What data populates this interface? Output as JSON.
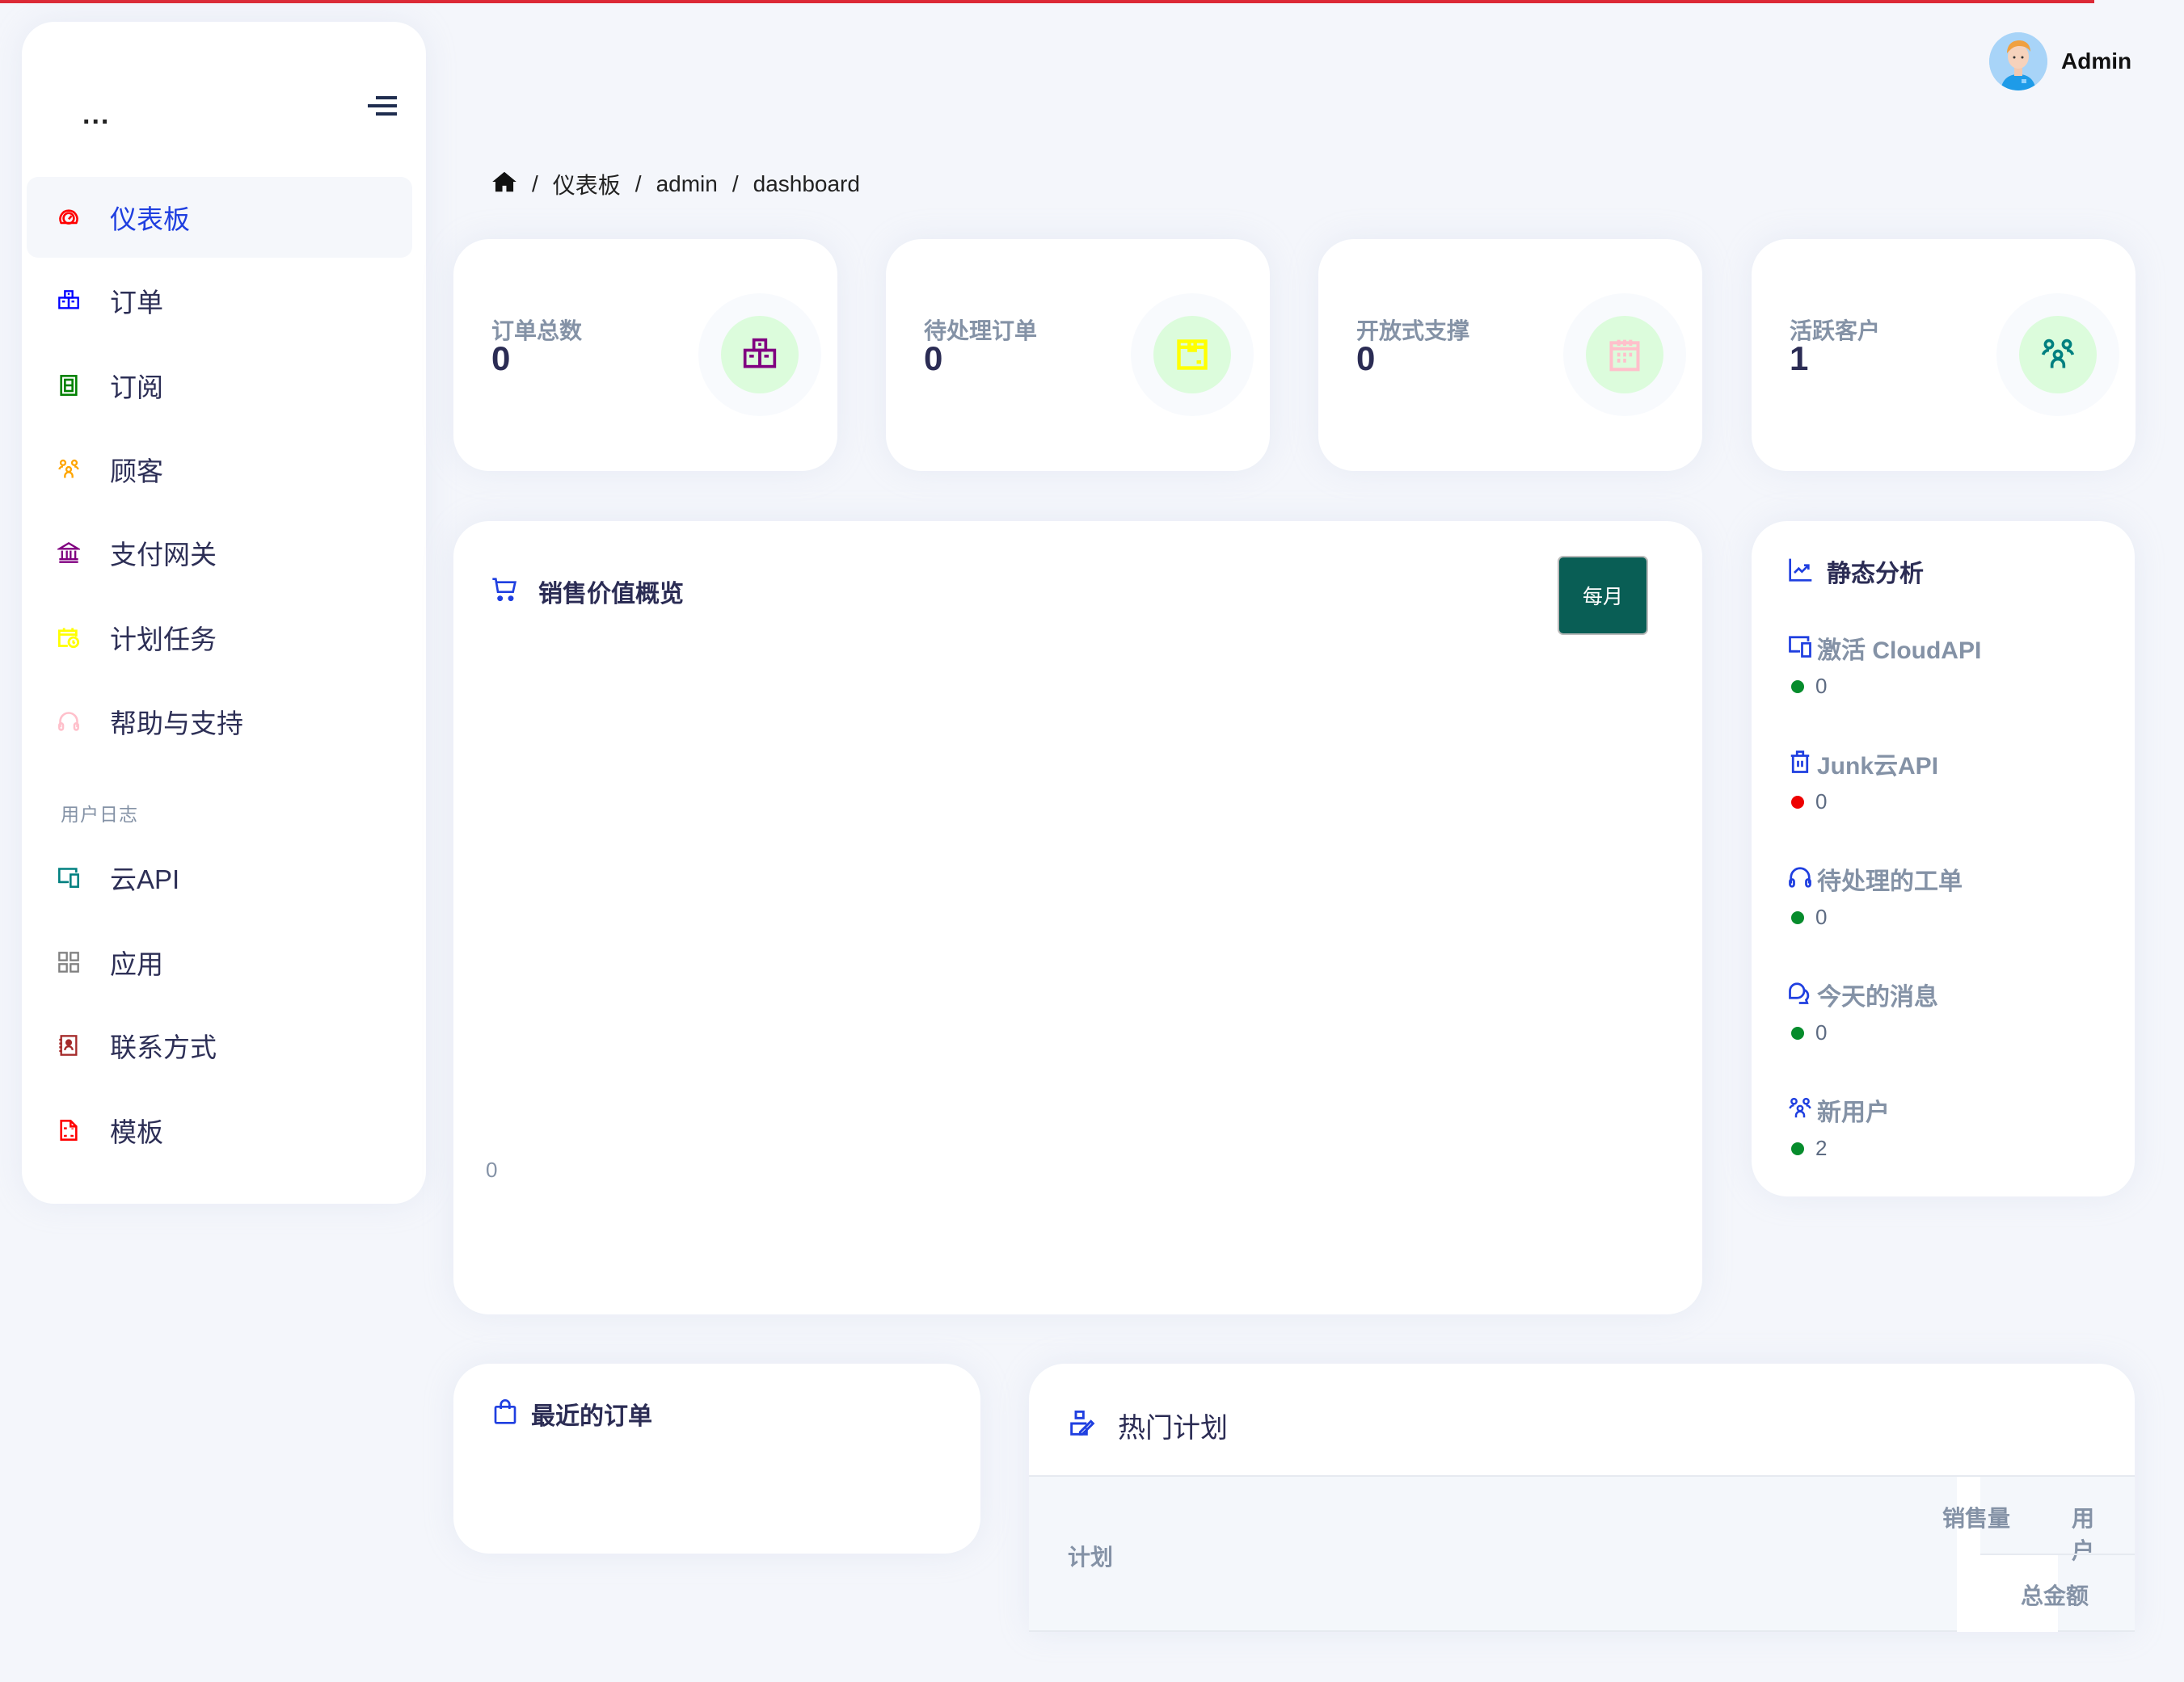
{
  "header": {
    "user_name": "Admin",
    "avatar_icon": "user-avatar"
  },
  "breadcrumb": {
    "home_icon": "home-icon",
    "items": [
      "仪表板",
      "admin",
      "dashboard"
    ],
    "separator": "/"
  },
  "sidebar": {
    "more_label": "...",
    "toggle_icon": "menu-toggle-icon",
    "items": [
      {
        "label": "仪表板",
        "icon": "dashboard-gauge-icon",
        "color": "#ff0000",
        "active": true
      },
      {
        "label": "订单",
        "icon": "boxes-icon",
        "color": "#0000ff"
      },
      {
        "label": "订阅",
        "icon": "subscription-icon",
        "color": "#008000"
      },
      {
        "label": "顾客",
        "icon": "users-icon",
        "color": "#ffa500"
      },
      {
        "label": "支付网关",
        "icon": "bank-icon",
        "color": "#800080"
      },
      {
        "label": "计划任务",
        "icon": "calendar-clock-icon",
        "color": "#ffff00"
      },
      {
        "label": "帮助与支持",
        "icon": "headset-icon",
        "color": "#ffc0cb"
      }
    ],
    "section_title": "用户日志",
    "section_items": [
      {
        "label": "云API",
        "icon": "devices-icon",
        "color": "#008080"
      },
      {
        "label": "应用",
        "icon": "apps-grid-icon",
        "color": "#808080"
      },
      {
        "label": "联系方式",
        "icon": "contact-book-icon",
        "color": "#a52a2a"
      },
      {
        "label": "模板",
        "icon": "template-file-icon",
        "color": "#ff0000"
      }
    ]
  },
  "stats": [
    {
      "title": "订单总数",
      "value": "0",
      "icon": "boxes-icon",
      "color": "#800080"
    },
    {
      "title": "待处理订单",
      "value": "0",
      "icon": "package-icon",
      "color": "#ffff00"
    },
    {
      "title": "开放式支撑",
      "value": "0",
      "icon": "calendar-icon",
      "color": "#ffc0cb"
    },
    {
      "title": "活跃客户",
      "value": "1",
      "icon": "users-icon",
      "color": "#008080"
    }
  ],
  "sales": {
    "title": "销售价值概览",
    "icon": "cart-icon",
    "period_button": "每月"
  },
  "chart_data": {
    "type": "line",
    "title": "销售价值概览",
    "categories": [],
    "series": [],
    "y_ticks": [
      "0"
    ],
    "xlabel": "",
    "ylabel": "",
    "grid": false
  },
  "static_analysis": {
    "title": "静态分析",
    "icon": "trend-chart-icon",
    "items": [
      {
        "label": "激活 CloudAPI",
        "icon": "devices-icon",
        "value": "0",
        "status_color": "#068c2c"
      },
      {
        "label": "Junk云API",
        "icon": "trash-icon",
        "value": "0",
        "status_color": "#ee0000"
      },
      {
        "label": "待处理的工单",
        "icon": "headset-icon",
        "value": "0",
        "status_color": "#068c2c"
      },
      {
        "label": "今天的消息",
        "icon": "chat-icon",
        "value": "0",
        "status_color": "#068c2c"
      },
      {
        "label": "新用户",
        "icon": "users-icon",
        "value": "2",
        "status_color": "#068c2c"
      }
    ]
  },
  "recent_orders": {
    "title": "最近的订单",
    "icon": "shopping-bag-icon"
  },
  "hot_plans": {
    "title": "热门计划",
    "icon": "plan-edit-icon",
    "columns": [
      "计划",
      "销售量",
      "用户",
      "总金额"
    ]
  },
  "colors": {
    "accent": "#1f3fe0",
    "loading_bar": "#dc2a36",
    "button_bg": "#095e55",
    "icon_circle_bg": "#dcfcdc"
  }
}
